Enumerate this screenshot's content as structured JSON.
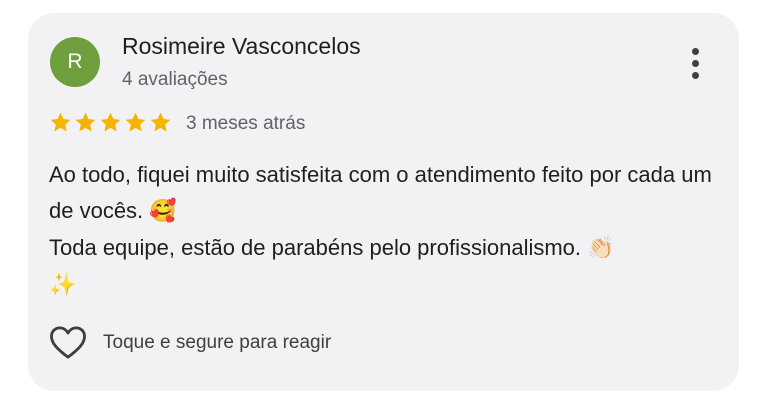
{
  "review": {
    "author": {
      "initial": "R",
      "name": "Rosimeire Vasconcelos",
      "review_count": "4 avaliações",
      "avatar_color": "#6f9e3c"
    },
    "menu_icon": "more-vertical-icon",
    "rating": 5,
    "rating_max": 5,
    "star_color": "#f4b400",
    "time_ago": "3 meses atrás",
    "text_line_1": "Ao todo, fiquei muito satisfeita com o atendimento feito por cada um de vocês.",
    "emoji_1": "🥰",
    "text_line_2": "Toda equipe, estão de parabéns pelo profissionalismo.",
    "emoji_2": "👏🏻",
    "emoji_3": "✨",
    "react": {
      "icon": "heart-outline-icon",
      "label": "Toque e segure para reagir"
    }
  }
}
